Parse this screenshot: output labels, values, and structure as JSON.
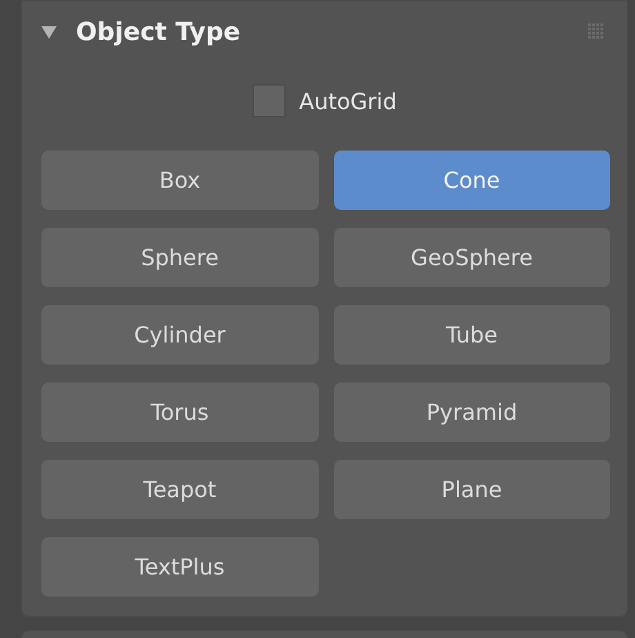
{
  "rollout": {
    "title": "Object Type",
    "expanded": true
  },
  "autogrid": {
    "label": "AutoGrid",
    "checked": false
  },
  "buttons": [
    {
      "label": "Box",
      "selected": false
    },
    {
      "label": "Cone",
      "selected": true
    },
    {
      "label": "Sphere",
      "selected": false
    },
    {
      "label": "GeoSphere",
      "selected": false
    },
    {
      "label": "Cylinder",
      "selected": false
    },
    {
      "label": "Tube",
      "selected": false
    },
    {
      "label": "Torus",
      "selected": false
    },
    {
      "label": "Pyramid",
      "selected": false
    },
    {
      "label": "Teapot",
      "selected": false
    },
    {
      "label": "Plane",
      "selected": false
    },
    {
      "label": "TextPlus",
      "selected": false
    }
  ]
}
